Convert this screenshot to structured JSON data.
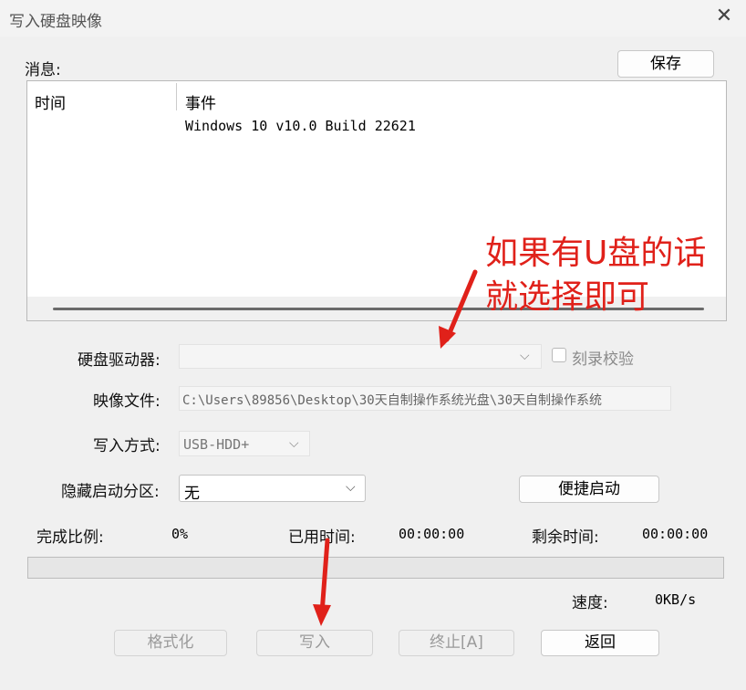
{
  "window": {
    "title": "写入硬盘映像",
    "close_glyph": "✕"
  },
  "messages": {
    "label": "消息:",
    "save_button": "保存",
    "columns": [
      "时间",
      "事件"
    ],
    "rows": [
      {
        "time": "",
        "event": "Windows 10 v10.0 Build 22621"
      }
    ]
  },
  "form": {
    "drive_label": "硬盘驱动器:",
    "drive_value": "",
    "verify_label": "刻录校验",
    "verify_checked": false,
    "image_label": "映像文件:",
    "image_value": "C:\\Users\\89856\\Desktop\\30天自制操作系统光盘\\30天自制操作系统",
    "method_label": "写入方式:",
    "method_value": "USB-HDD+",
    "hidden_label": "隐藏启动分区:",
    "hidden_value": "无",
    "quick_boot_button": "便捷启动"
  },
  "status": {
    "done_label": "完成比例:",
    "done_value": "0%",
    "used_label": "已用时间:",
    "used_value": "00:00:00",
    "remain_label": "剩余时间:",
    "remain_value": "00:00:00",
    "speed_label": "速度:",
    "speed_value": "0KB/s",
    "progress_fraction": 0
  },
  "buttons": {
    "format": "格式化",
    "write": "写入",
    "abort": "终止[A]",
    "back": "返回"
  },
  "annotation": {
    "line1": "如果有U盘的话",
    "line2": "就选择即可",
    "color": "#e0211a"
  },
  "icons": {
    "close": "close-icon",
    "dropdown": "chevron-down-icon"
  }
}
